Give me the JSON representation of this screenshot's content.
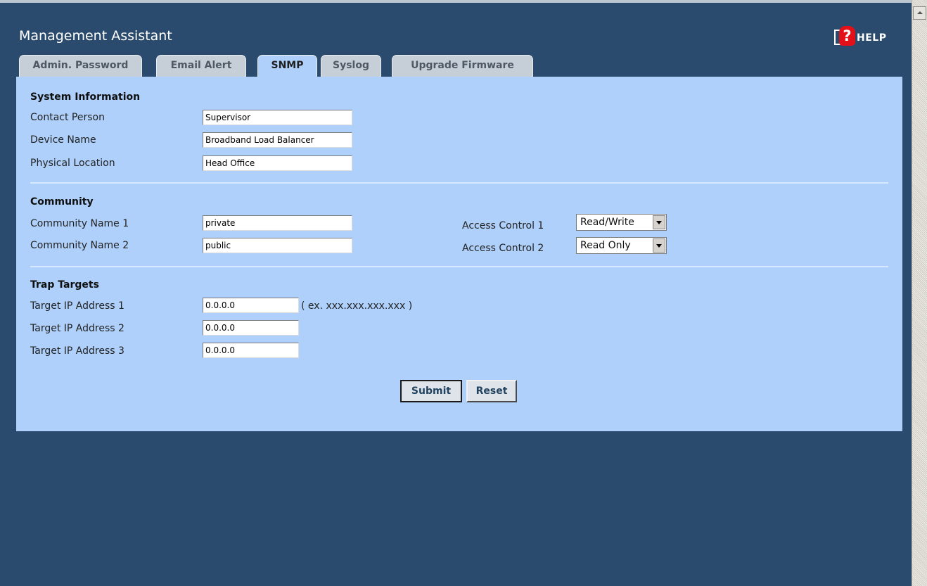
{
  "app": {
    "title": "Management Assistant",
    "help_label": "HELP",
    "help_mark": "?"
  },
  "tabs": [
    {
      "label": "Admin. Password"
    },
    {
      "label": "Email Alert"
    },
    {
      "label": "SNMP"
    },
    {
      "label": "Syslog"
    },
    {
      "label": "Upgrade Firmware"
    }
  ],
  "system_info": {
    "title": "System Information",
    "contact_label": "Contact Person",
    "contact_value": "Supervisor",
    "device_label": "Device Name",
    "device_value": "Broadband Load Balancer",
    "location_label": "Physical Location",
    "location_value": "Head Office"
  },
  "community": {
    "title": "Community",
    "name1_label": "Community Name 1",
    "name1_value": "private",
    "name2_label": "Community Name 2",
    "name2_value": "public",
    "access1_label": "Access Control 1",
    "access1_value": "Read/Write",
    "access2_label": "Access Control 2",
    "access2_value": "Read Only"
  },
  "trap": {
    "title": "Trap Targets",
    "ip1_label": "Target IP Address 1",
    "ip1_value": "0.0.0.0",
    "ip_hint": "( ex. xxx.xxx.xxx.xxx )",
    "ip2_label": "Target IP Address 2",
    "ip2_value": "0.0.0.0",
    "ip3_label": "Target IP Address 3",
    "ip3_value": "0.0.0.0"
  },
  "buttons": {
    "submit": "Submit",
    "reset": "Reset"
  },
  "colors": {
    "background": "#2a4b6d",
    "panel": "#aed0fa",
    "tab_inactive": "#c6cfd8",
    "help_red": "#e3101a"
  }
}
